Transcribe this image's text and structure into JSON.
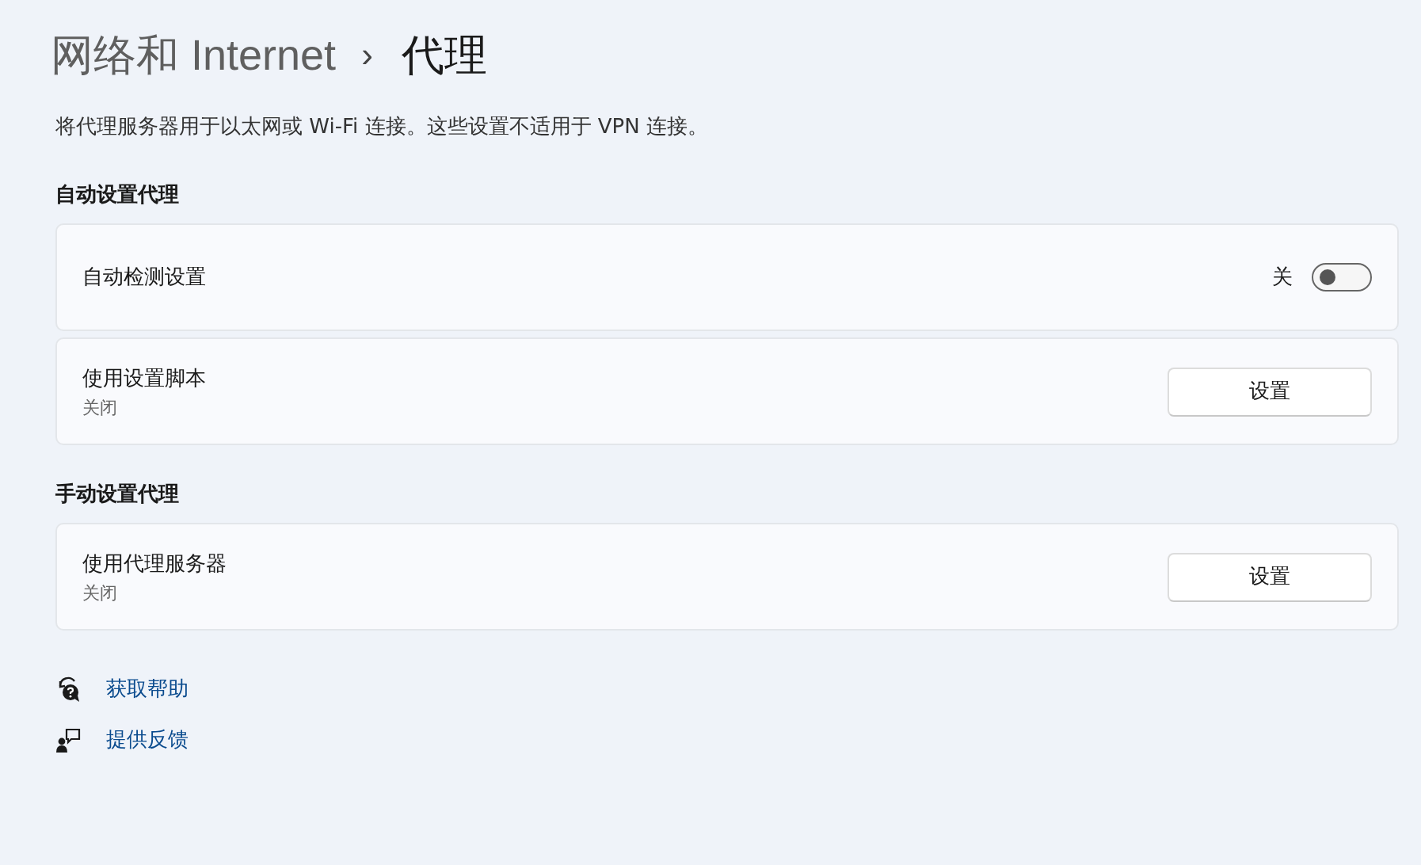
{
  "breadcrumb": {
    "parent": "网络和 Internet",
    "separator": "›",
    "current": "代理"
  },
  "description": "将代理服务器用于以太网或 Wi-Fi 连接。这些设置不适用于 VPN 连接。",
  "sections": [
    {
      "heading": "自动设置代理",
      "rows": [
        {
          "kind": "toggle",
          "title": "自动检测设置",
          "state_label": "关",
          "on": false
        },
        {
          "kind": "button",
          "title": "使用设置脚本",
          "subtitle": "关闭",
          "button": "设置"
        }
      ]
    },
    {
      "heading": "手动设置代理",
      "rows": [
        {
          "kind": "button",
          "title": "使用代理服务器",
          "subtitle": "关闭",
          "button": "设置"
        }
      ]
    }
  ],
  "links": [
    {
      "kind": "help",
      "label": "获取帮助"
    },
    {
      "kind": "feedback",
      "label": "提供反馈"
    }
  ]
}
